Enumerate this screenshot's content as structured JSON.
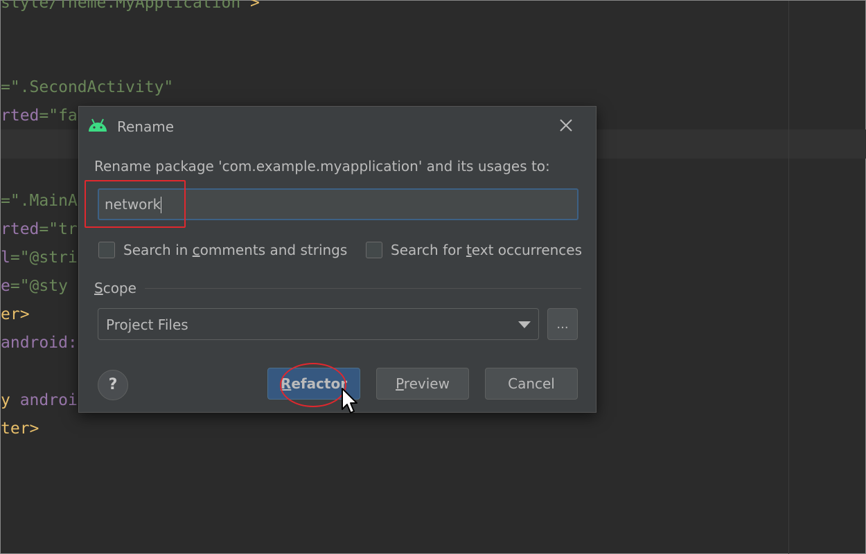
{
  "editor": {
    "lines": [
      {
        "parts": [
          {
            "t": "style/Theme.MyApplication",
            "c": "tok-green"
          },
          {
            "t": " >",
            "c": "tok-yellow"
          }
        ]
      },
      {
        "parts": [
          {
            "t": "=",
            "c": "tok-green"
          },
          {
            "t": "\".SecondActivity\"",
            "c": "tok-green"
          }
        ]
      },
      {
        "parts": [
          {
            "t": "rted",
            "c": "tok-purple"
          },
          {
            "t": "=\"fa",
            "c": "tok-green"
          }
        ]
      },
      {
        "parts": [
          {
            "t": "=",
            "c": "tok-green"
          },
          {
            "t": "\".MainA",
            "c": "tok-green"
          }
        ]
      },
      {
        "parts": [
          {
            "t": "rted",
            "c": "tok-purple"
          },
          {
            "t": "=\"tr",
            "c": "tok-green"
          }
        ]
      },
      {
        "parts": [
          {
            "t": "l",
            "c": "tok-purple"
          },
          {
            "t": "=\"@stri",
            "c": "tok-green"
          }
        ]
      },
      {
        "parts": [
          {
            "t": "e",
            "c": "tok-purple"
          },
          {
            "t": "=\"@sty",
            "c": "tok-green"
          }
        ]
      },
      {
        "parts": [
          {
            "t": "er>",
            "c": "tok-yellow"
          }
        ]
      },
      {
        "parts": [
          {
            "t": "android:",
            "c": "tok-purple"
          }
        ]
      },
      {
        "parts": [
          {
            "t": "y ",
            "c": "tok-yellow"
          },
          {
            "t": "androi",
            "c": "tok-purple"
          }
        ]
      },
      {
        "parts": [
          {
            "t": "ter>",
            "c": "tok-yellow"
          }
        ]
      }
    ]
  },
  "dialog": {
    "title": "Rename",
    "prompt": "Rename package 'com.example.myapplication' and its usages to:",
    "input_value": "network",
    "check_comments_pre": "Search in ",
    "check_comments_u": "c",
    "check_comments_post": "omments and strings",
    "check_text_pre": "Search for ",
    "check_text_u": "t",
    "check_text_post": "ext occurrences",
    "scope_u": "S",
    "scope_rest": "cope",
    "scope_value": "Project Files",
    "browse_label": "...",
    "help_label": "?",
    "refactor_u": "R",
    "refactor_rest": "efactor",
    "preview_u": "P",
    "preview_rest": "review",
    "cancel_label": "Cancel"
  }
}
